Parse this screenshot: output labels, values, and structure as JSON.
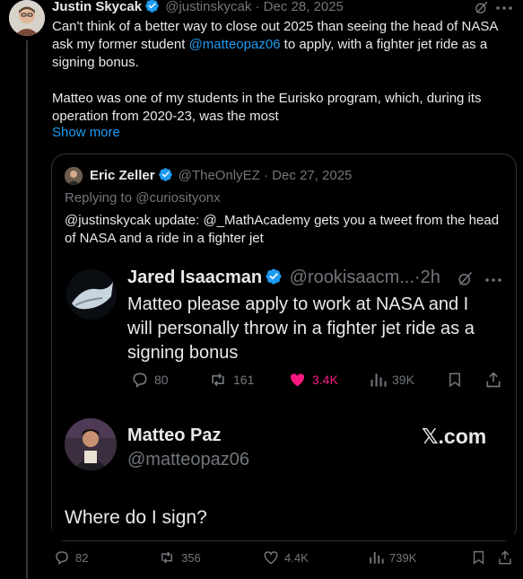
{
  "tweet": {
    "author_name": "Justin Skycak",
    "handle": "@justinskycak",
    "date": "Dec 28, 2025",
    "text_before_mention": "Can't think of a better way to close out 2025 than seeing the head of NASA ask my former student ",
    "mention": "@matteopaz06",
    "text_after_mention": " to apply, with a fighter jet ride as a signing bonus.",
    "paragraph2": "Matteo was one of my students in the Eurisko program, which, during its operation from 2020-23, was the most",
    "show_more": "Show more"
  },
  "quote": {
    "author_name": "Eric Zeller",
    "handle": "@TheOnlyEZ",
    "date": "Dec 27, 2025",
    "replying_to": "Replying to @curiosityonx",
    "text": "@justinskycak update: @_MathAcademy gets you a tweet from the head of NASA and a ride in a fighter jet"
  },
  "embedded_jared": {
    "author_name": "Jared Isaacman",
    "handle": "@rookisaacm...",
    "time": "2h",
    "text": "Matteo please apply to work at NASA and I will personally throw in a fighter jet ride as a signing bonus",
    "replies": "80",
    "reposts": "161",
    "likes": "3.4K",
    "views": "39K"
  },
  "embedded_matteo": {
    "author_name": "Matteo Paz",
    "handle": "@matteopaz06",
    "brand": "𝕏.com",
    "text": "Where do I sign?"
  },
  "actions": {
    "replies": "82",
    "reposts": "356",
    "likes": "4.4K",
    "views": "739K"
  },
  "colors": {
    "background": "#000000",
    "text": "#e7e9ea",
    "muted": "#71767b",
    "link": "#1d9bf0",
    "like": "#f91880",
    "border": "#2f3336"
  },
  "icons": [
    "verified-badge-icon",
    "grok-icon",
    "more-icon",
    "reply-icon",
    "repost-icon",
    "like-icon",
    "views-icon",
    "bookmark-icon",
    "share-icon"
  ]
}
